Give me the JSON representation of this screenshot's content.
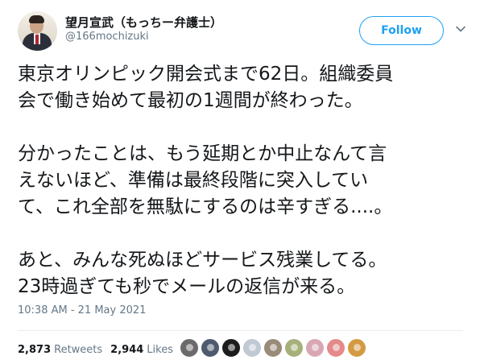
{
  "author": {
    "display_name": "望月宣武（もっちー弁護士）",
    "handle": "@166mochizuki"
  },
  "follow_button": {
    "label": "Follow",
    "color": "#1da1f2"
  },
  "tweet": {
    "lines": [
      "東京オリンピック開会式まで62日。組織委員",
      "会で働き始めて最初の1週間が終わった。",
      "",
      "分かったことは、もう延期とか中止なんて言",
      "えないほど、準備は最終段階に突入してい",
      "て、これ全部を無駄にするのは辛すぎる....。",
      "",
      "あと、みんな死ぬほどサービス残業してる。",
      "23時過ぎても秒でメールの返信が来る。"
    ]
  },
  "timestamp": "10:38 AM - 21 May 2021",
  "stats": {
    "retweets_count": "2,873",
    "retweets_label": "Retweets",
    "likes_count": "2,944",
    "likes_label": "Likes"
  },
  "liker_avatars": [
    {
      "icon": "liker-avatar",
      "color": "#6b6b6b"
    },
    {
      "icon": "liker-avatar",
      "color": "#4f5a6e"
    },
    {
      "icon": "liker-avatar",
      "color": "#1c1c1c"
    },
    {
      "icon": "liker-avatar",
      "color": "#bfc8d3"
    },
    {
      "icon": "liker-avatar",
      "color": "#9a8a7a"
    },
    {
      "icon": "liker-avatar",
      "color": "#a5b07a"
    },
    {
      "icon": "liker-avatar",
      "color": "#d9a7b4"
    },
    {
      "icon": "liker-avatar",
      "color": "#e48a8a"
    },
    {
      "icon": "liker-avatar",
      "color": "#d49a43"
    }
  ]
}
